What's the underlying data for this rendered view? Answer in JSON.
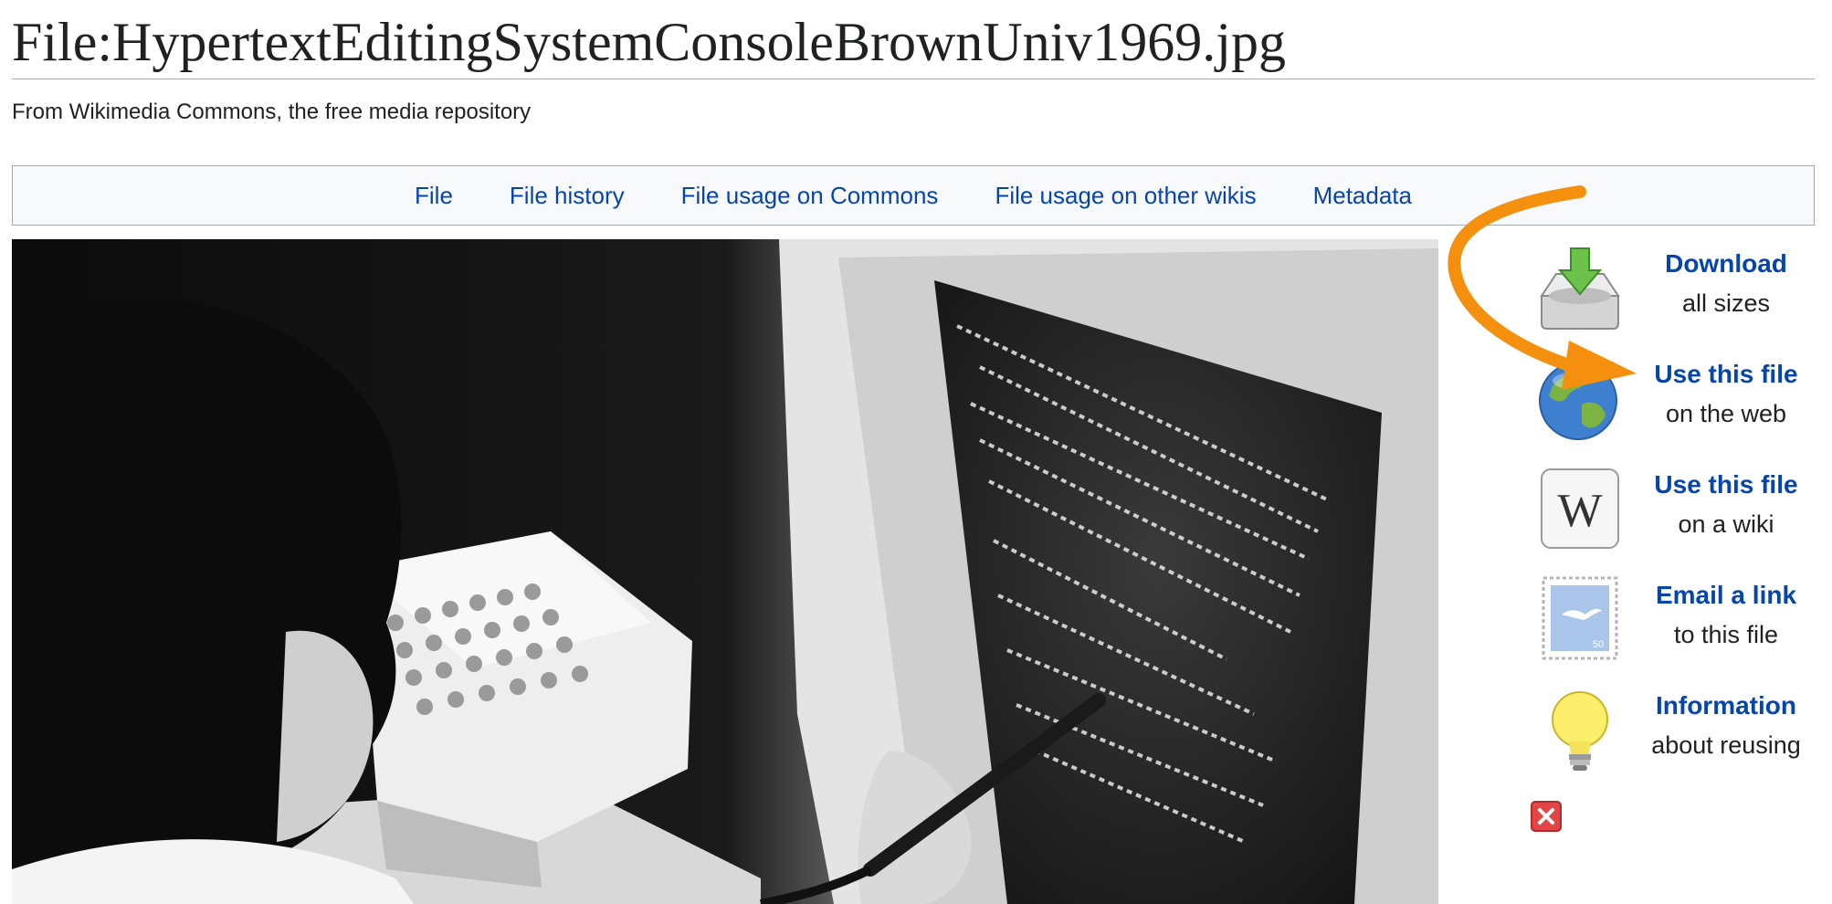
{
  "page": {
    "title": "File:HypertextEditingSystemConsoleBrownUniv1969.jpg",
    "tagline": "From Wikimedia Commons, the free media repository"
  },
  "tabs": [
    {
      "label": "File"
    },
    {
      "label": "File history"
    },
    {
      "label": "File usage on Commons"
    },
    {
      "label": "File usage on other wikis"
    },
    {
      "label": "Metadata"
    }
  ],
  "sidebar": {
    "items": [
      {
        "title": "Download",
        "subtitle": "all sizes",
        "icon": "download-icon"
      },
      {
        "title": "Use this file",
        "subtitle": "on the web",
        "icon": "globe-icon"
      },
      {
        "title": "Use this file",
        "subtitle": "on a wiki",
        "icon": "wikipedia-icon"
      },
      {
        "title": "Email a link",
        "subtitle": "to this file",
        "icon": "stamp-icon"
      },
      {
        "title": "Information",
        "subtitle": "about reusing",
        "icon": "lightbulb-icon"
      }
    ],
    "close_icon": "close-icon"
  },
  "colors": {
    "link": "#0645ad",
    "arrow": "#f5900f",
    "tab_bar_bg": "#f8f9fa",
    "border": "#a2a9b1"
  }
}
